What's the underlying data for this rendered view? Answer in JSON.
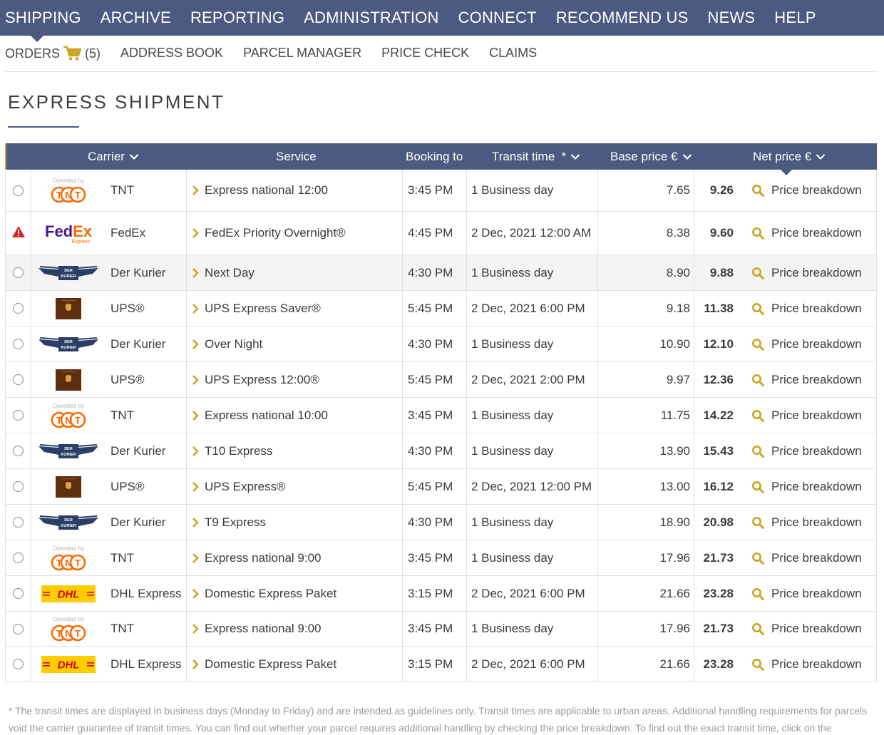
{
  "topnav": {
    "items": [
      "SHIPPING",
      "ARCHIVE",
      "REPORTING",
      "ADMINISTRATION",
      "CONNECT",
      "RECOMMEND US",
      "NEWS",
      "HELP"
    ]
  },
  "subnav": {
    "orders_label": "ORDERS",
    "orders_count": "(5)",
    "address_book": "ADDRESS BOOK",
    "parcel_manager": "PARCEL MANAGER",
    "price_check": "PRICE CHECK",
    "claims": "CLAIMS"
  },
  "page": {
    "title": "EXPRESS SHIPMENT"
  },
  "table": {
    "headers": {
      "carrier": "Carrier",
      "service": "Service",
      "booking_to": "Booking to",
      "transit_time": "Transit time  *",
      "base_price": "Base price €",
      "net_price": "Net price €"
    },
    "breakdown_label": "Price breakdown",
    "rows": [
      {
        "status": "radio",
        "logo": "tnt",
        "carrier": "TNT",
        "service": "Express national 12:00",
        "booking": "3:45 PM",
        "transit": "1 Business day",
        "base": "7.65",
        "net": "9.26"
      },
      {
        "status": "warning",
        "logo": "fedex",
        "carrier": "FedEx",
        "service": "FedEx Priority Overnight®",
        "booking": "4:45 PM",
        "transit": "2 Dec, 2021 12:00 AM",
        "base": "8.38",
        "net": "9.60"
      },
      {
        "status": "radio",
        "logo": "derkurier",
        "carrier": "Der Kurier",
        "service": "Next Day",
        "booking": "4:30 PM",
        "transit": "1 Business day",
        "base": "8.90",
        "net": "9.88"
      },
      {
        "status": "radio",
        "logo": "ups",
        "carrier": "UPS®",
        "service": "UPS Express Saver®",
        "booking": "5:45 PM",
        "transit": "2 Dec, 2021 6:00 PM",
        "base": "9.18",
        "net": "11.38"
      },
      {
        "status": "radio",
        "logo": "derkurier",
        "carrier": "Der Kurier",
        "service": "Over Night",
        "booking": "4:30 PM",
        "transit": "1 Business day",
        "base": "10.90",
        "net": "12.10"
      },
      {
        "status": "radio",
        "logo": "ups",
        "carrier": "UPS®",
        "service": "UPS Express 12:00®",
        "booking": "5:45 PM",
        "transit": "2 Dec, 2021 2:00 PM",
        "base": "9.97",
        "net": "12.36"
      },
      {
        "status": "radio",
        "logo": "tnt",
        "carrier": "TNT",
        "service": "Express national 10:00",
        "booking": "3:45 PM",
        "transit": "1 Business day",
        "base": "11.75",
        "net": "14.22"
      },
      {
        "status": "radio",
        "logo": "derkurier",
        "carrier": "Der Kurier",
        "service": "T10 Express",
        "booking": "4:30 PM",
        "transit": "1 Business day",
        "base": "13.90",
        "net": "15.43"
      },
      {
        "status": "radio",
        "logo": "ups",
        "carrier": "UPS®",
        "service": "UPS Express®",
        "booking": "5:45 PM",
        "transit": "2 Dec, 2021 12:00 PM",
        "base": "13.00",
        "net": "16.12"
      },
      {
        "status": "radio",
        "logo": "derkurier",
        "carrier": "Der Kurier",
        "service": "T9 Express",
        "booking": "4:30 PM",
        "transit": "1 Business day",
        "base": "18.90",
        "net": "20.98"
      },
      {
        "status": "radio",
        "logo": "tnt",
        "carrier": "TNT",
        "service": "Express national 9:00",
        "booking": "3:45 PM",
        "transit": "1 Business day",
        "base": "17.96",
        "net": "21.73"
      },
      {
        "status": "radio",
        "logo": "dhl",
        "carrier": "DHL Express",
        "service": "Domestic Express Paket",
        "booking": "3:15 PM",
        "transit": "2 Dec, 2021 6:00 PM",
        "base": "21.66",
        "net": "23.28"
      },
      {
        "status": "radio",
        "logo": "tnt",
        "carrier": "TNT",
        "service": "Express national 9:00",
        "booking": "3:45 PM",
        "transit": "1 Business day",
        "base": "17.96",
        "net": "21.73"
      },
      {
        "status": "radio",
        "logo": "dhl",
        "carrier": "DHL Express",
        "service": "Domestic Express Paket",
        "booking": "3:15 PM",
        "transit": "2 Dec, 2021 6:00 PM",
        "base": "21.66",
        "net": "23.28"
      }
    ]
  },
  "logos": {
    "tnt_operated_by": "Operated by",
    "tnt_text": "TNT",
    "fedex_fed": "Fed",
    "fedex_ex": "Ex",
    "fedex_express": "Express",
    "derkurier_top": "DER",
    "derkurier_bottom": "KURIER",
    "dhl_text": "DHL"
  },
  "footnote": "* The transit times are displayed in business days (Monday to Friday) and are intended as guidelines only. Transit times are applicable to urban areas. Additional handling requirements for parcels void the carrier guarantee of transit times. You can find out whether your parcel requires additional handling by checking the price breakdown. To find out the exact transit time, click on the",
  "colors": {
    "nav_bg": "#4a5a80",
    "accent_gold": "#c9a623",
    "warning_red": "#d62020",
    "tnt_orange": "#ff6600",
    "fedex_purple": "#4d148c",
    "ups_brown": "#5c2e0f",
    "dhl_yellow": "#ffcc00",
    "dhl_red": "#d40511"
  }
}
